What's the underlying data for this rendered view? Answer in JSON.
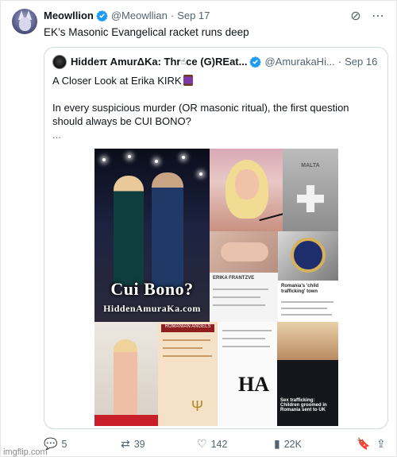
{
  "post": {
    "author_name": "Meowllion",
    "handle": "@Meowllian",
    "date": "Sep 17",
    "text": "EK’s Masonic Evangelical racket runs deep"
  },
  "quoted": {
    "author_name": "Hiddeπ AmurΔKa: Thr",
    "author_name_rest": "ce (G)REat...",
    "handle": "@AmurakaHi...",
    "date": "Sep 16",
    "line1": "A Closer Look at Erika KIRK",
    "line2": "In every suspicious murder (OR masonic ritual), the first question should always be CUI BONO?",
    "ellipsis": "...",
    "media": {
      "cui_bono": "Cui Bono?",
      "site": "HiddenAmuraKa.com",
      "badge_top": "MALTA",
      "tile_logo": "HA",
      "romanian_angels": "ROMANIAN ANGELS",
      "news_headline": "Romania's 'child trafficking' town",
      "erika_name": "ERIKA FRANTZVE",
      "trafficking_caption": "Sex trafficking: Children groomed in Romania sent to UK"
    }
  },
  "actions": {
    "replies": "5",
    "reposts": "39",
    "likes": "142",
    "views": "22K"
  },
  "watermark": "imgflip.com",
  "colors": {
    "verified": "#1d9bf0",
    "muted": "#536471",
    "border": "#cfd9de"
  }
}
